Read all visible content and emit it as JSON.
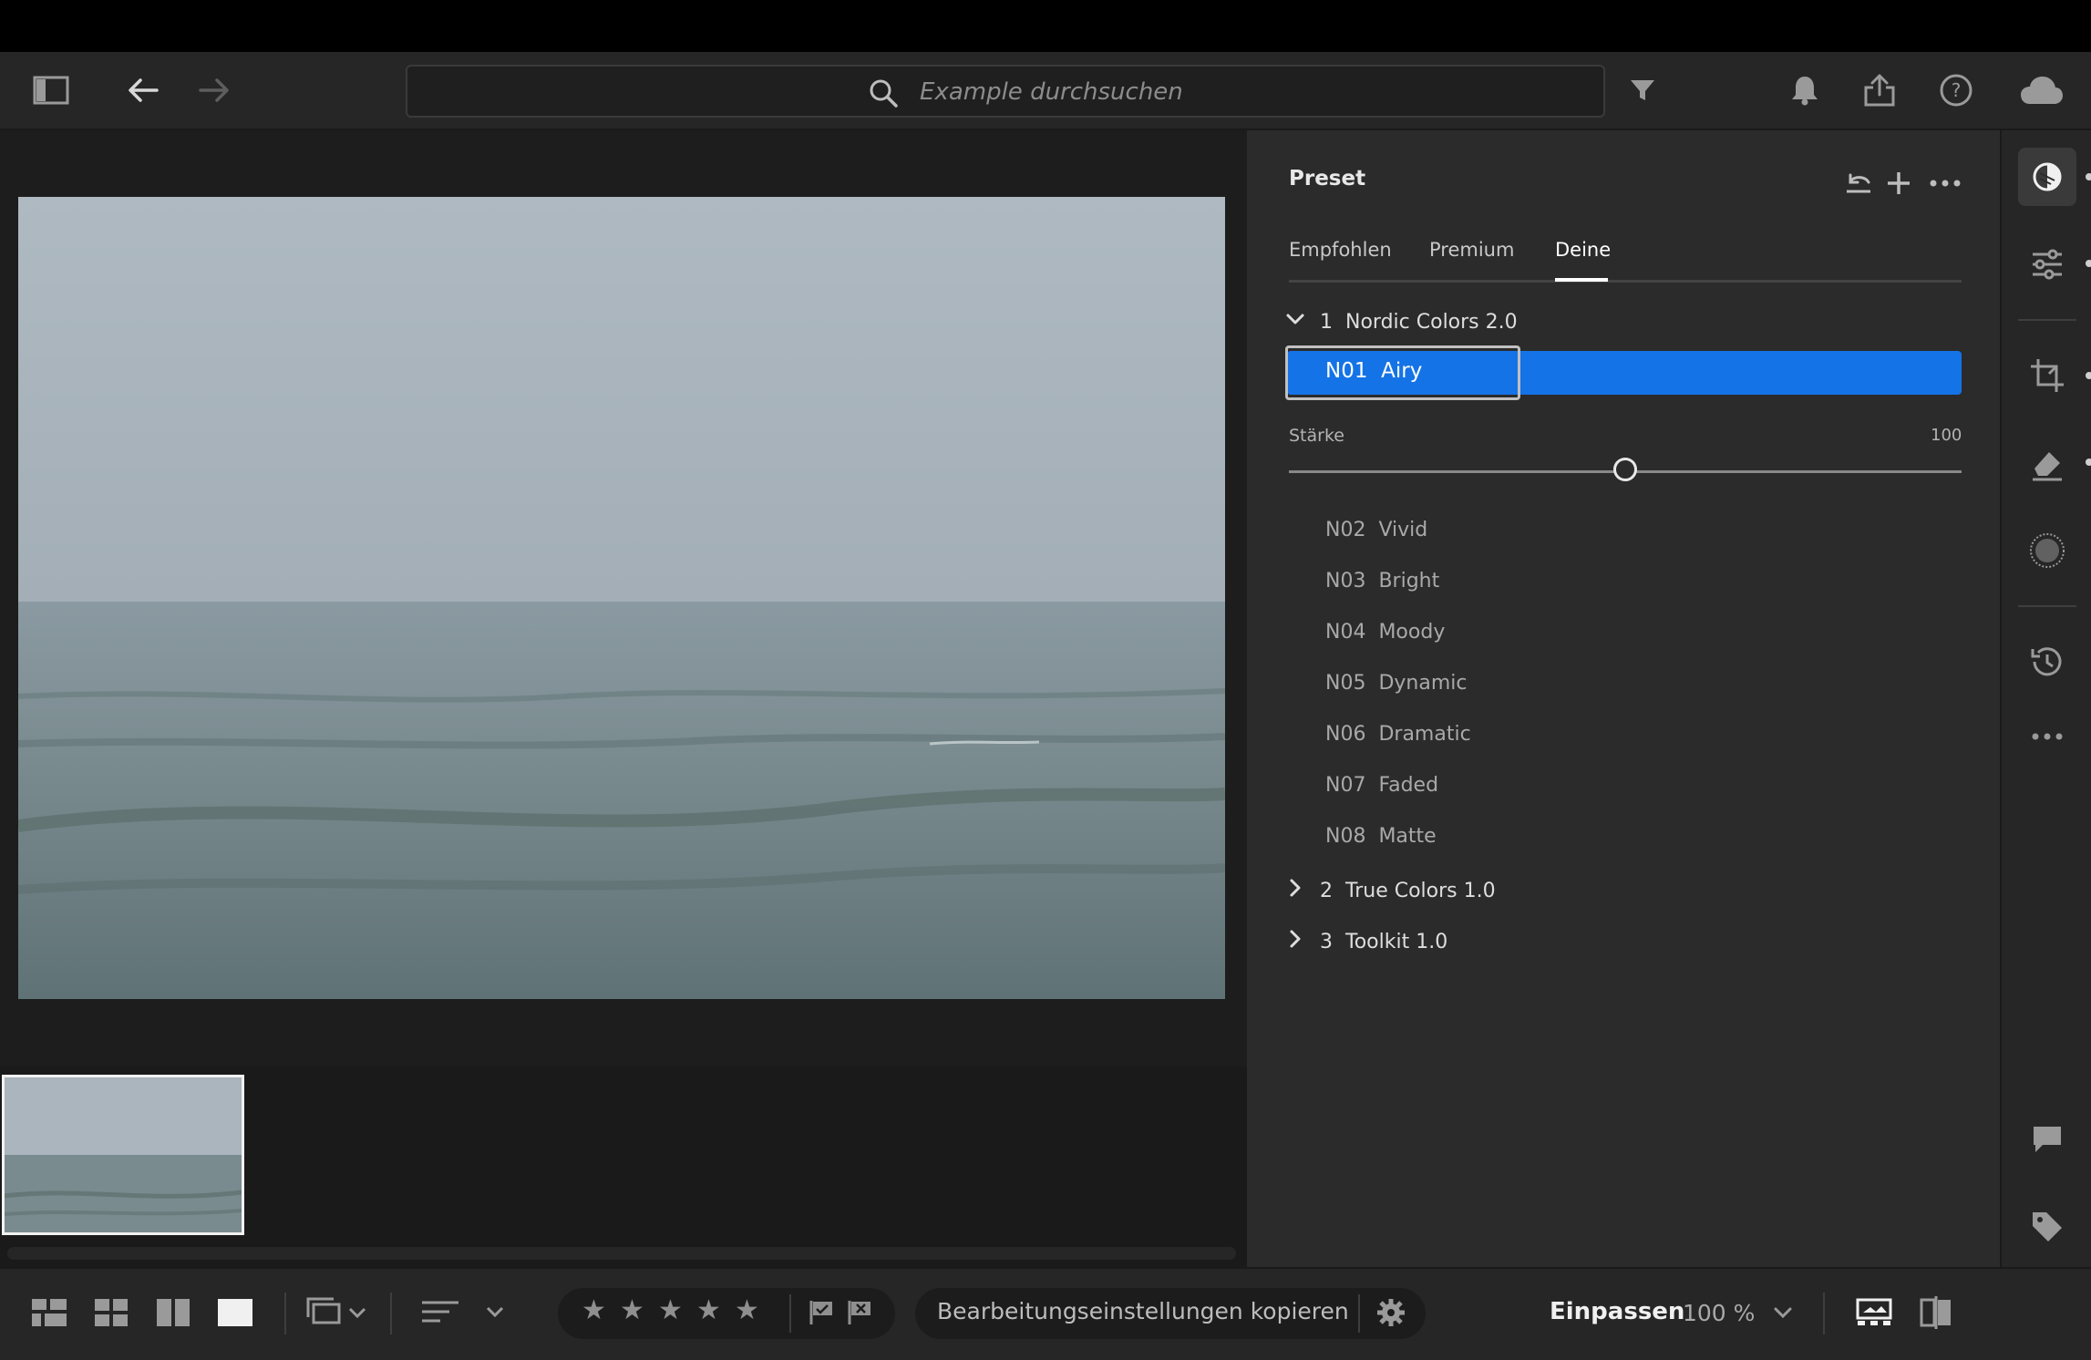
{
  "search": {
    "placeholder": "Example durchsuchen"
  },
  "panel": {
    "title": "Preset",
    "tabs": [
      {
        "label": "Empfohlen",
        "active": false
      },
      {
        "label": "Premium",
        "active": false
      },
      {
        "label": "Deine",
        "active": true
      }
    ],
    "groups": [
      {
        "num": "1",
        "name": "Nordic Colors 2.0",
        "expanded": true
      },
      {
        "num": "2",
        "name": "True Colors 1.0",
        "expanded": false
      },
      {
        "num": "3",
        "name": "Toolkit 1.0",
        "expanded": false
      }
    ],
    "selected": {
      "code": "N01",
      "name": "Airy"
    },
    "amount": {
      "label": "Stärke",
      "value": "100",
      "level": 0.5
    },
    "presets": [
      {
        "code": "N02",
        "name": "Vivid"
      },
      {
        "code": "N03",
        "name": "Bright"
      },
      {
        "code": "N04",
        "name": "Moody"
      },
      {
        "code": "N05",
        "name": "Dynamic"
      },
      {
        "code": "N06",
        "name": "Dramatic"
      },
      {
        "code": "N07",
        "name": "Faded"
      },
      {
        "code": "N08",
        "name": "Matte"
      }
    ]
  },
  "bottombar": {
    "copy_settings": "Bearbeitungseinstellungen kopieren",
    "fit": "Einpassen",
    "zoom": "100 %"
  },
  "colors": {
    "accent": "#1473e6",
    "panel_bg": "#2b2b2b",
    "toolbar_bg": "#262626"
  },
  "icons": [
    "panel-toggle-icon",
    "back-arrow-icon",
    "forward-arrow-icon",
    "search-icon",
    "filter-icon",
    "bell-icon",
    "share-icon",
    "help-icon",
    "cloud-icon",
    "undo-icon",
    "plus-icon",
    "more-icon",
    "presets-icon",
    "adjust-icon",
    "crop-icon",
    "healing-icon",
    "masking-icon",
    "history-icon",
    "comment-icon",
    "tag-icon",
    "info-icon",
    "gear-icon",
    "flag-icon",
    "reject-flag-icon"
  ]
}
